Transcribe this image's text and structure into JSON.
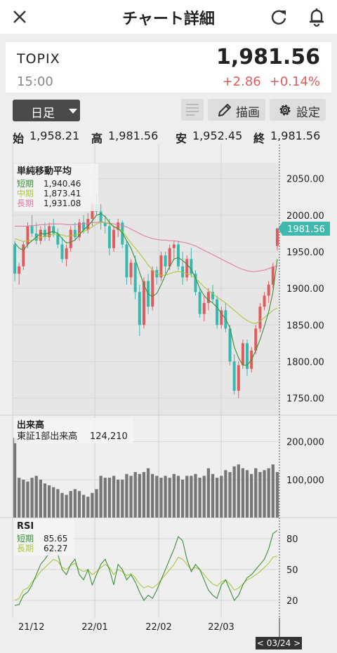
{
  "header": {
    "title": "チャート詳細"
  },
  "quote": {
    "symbol": "TOPIX",
    "time": "15:00",
    "price": "1,981.56",
    "change": "+2.86",
    "change_pct": "+0.14%"
  },
  "controls": {
    "period": "日足",
    "draw_label": "描画",
    "settings_label": "設定"
  },
  "ohlc": [
    {
      "key": "始",
      "value": "1,958.21"
    },
    {
      "key": "高",
      "value": "1,981.56"
    },
    {
      "key": "安",
      "value": "1,952.45"
    },
    {
      "key": "終",
      "value": "1,981.56"
    }
  ],
  "colors": {
    "up": "#e05b5b",
    "down": "#35b8b0",
    "short_ma": "#3a8e3a",
    "mid_ma": "#a8c83a",
    "long_ma": "#e07aa8",
    "volume": "#777777",
    "rsi_short": "#3a8e3a",
    "rsi_long": "#a8c83a",
    "accent": "#3fb8ad"
  },
  "chart_data": [
    {
      "type": "line",
      "title": "単純移動平均",
      "legend": [
        {
          "name": "短期",
          "value": "1,940.46"
        },
        {
          "name": "中期",
          "value": "1,873.41"
        },
        {
          "name": "長期",
          "value": "1,931.08"
        }
      ],
      "y_ticks": [
        "2050.00",
        "2000.00",
        "1950.00",
        "1900.00",
        "1850.00",
        "1800.00",
        "1750.00"
      ],
      "ylim": [
        1740,
        2065
      ],
      "x_ticks": [
        "21/12",
        "22/01",
        "22/02",
        "22/03"
      ],
      "last_price_label": "1981.56",
      "candles": [
        [
          1960,
          1965,
          1910,
          1920
        ],
        [
          1920,
          1935,
          1905,
          1930
        ],
        [
          1930,
          1965,
          1925,
          1960
        ],
        [
          1960,
          1990,
          1955,
          1985
        ],
        [
          1985,
          2000,
          1970,
          1975
        ],
        [
          1975,
          1990,
          1960,
          1965
        ],
        [
          1965,
          1985,
          1960,
          1980
        ],
        [
          1980,
          1990,
          1965,
          1970
        ],
        [
          1970,
          1990,
          1965,
          1985
        ],
        [
          1985,
          1995,
          1970,
          1975
        ],
        [
          1975,
          1982,
          1955,
          1960
        ],
        [
          1960,
          1970,
          1935,
          1940
        ],
        [
          1940,
          1960,
          1930,
          1955
        ],
        [
          1955,
          1985,
          1950,
          1980
        ],
        [
          1980,
          1990,
          1965,
          1970
        ],
        [
          1970,
          1995,
          1965,
          1990
        ],
        [
          1990,
          2000,
          1975,
          1980
        ],
        [
          1980,
          2003,
          1975,
          1995
        ],
        [
          1995,
          2020,
          1985,
          2015
        ],
        [
          2015,
          2030,
          2000,
          2005
        ],
        [
          2005,
          2015,
          1980,
          1990
        ],
        [
          1990,
          2000,
          1975,
          1985
        ],
        [
          1985,
          1995,
          1945,
          1955
        ],
        [
          1955,
          1985,
          1950,
          1980
        ],
        [
          1980,
          1995,
          1970,
          1990
        ],
        [
          1990,
          1993,
          1955,
          1960
        ],
        [
          1960,
          1965,
          1905,
          1915
        ],
        [
          1915,
          1940,
          1905,
          1935
        ],
        [
          1935,
          1945,
          1885,
          1895
        ],
        [
          1895,
          1905,
          1835,
          1850
        ],
        [
          1850,
          1915,
          1845,
          1910
        ],
        [
          1910,
          1920,
          1865,
          1875
        ],
        [
          1875,
          1930,
          1870,
          1925
        ],
        [
          1925,
          1930,
          1905,
          1915
        ],
        [
          1915,
          1950,
          1910,
          1945
        ],
        [
          1945,
          1950,
          1920,
          1930
        ],
        [
          1930,
          1960,
          1925,
          1955
        ],
        [
          1955,
          1965,
          1940,
          1960
        ],
        [
          1960,
          1965,
          1925,
          1930
        ],
        [
          1930,
          1950,
          1905,
          1915
        ],
        [
          1915,
          1945,
          1910,
          1940
        ],
        [
          1940,
          1955,
          1915,
          1920
        ],
        [
          1920,
          1925,
          1890,
          1895
        ],
        [
          1895,
          1900,
          1860,
          1865
        ],
        [
          1865,
          1890,
          1855,
          1880
        ],
        [
          1880,
          1900,
          1870,
          1895
        ],
        [
          1895,
          1905,
          1880,
          1885
        ],
        [
          1885,
          1890,
          1845,
          1850
        ],
        [
          1850,
          1875,
          1845,
          1870
        ],
        [
          1870,
          1880,
          1840,
          1845
        ],
        [
          1845,
          1850,
          1795,
          1800
        ],
        [
          1800,
          1810,
          1755,
          1760
        ],
        [
          1760,
          1800,
          1750,
          1795
        ],
        [
          1795,
          1830,
          1790,
          1825
        ],
        [
          1825,
          1830,
          1780,
          1790
        ],
        [
          1790,
          1820,
          1785,
          1815
        ],
        [
          1815,
          1850,
          1810,
          1845
        ],
        [
          1845,
          1880,
          1840,
          1875
        ],
        [
          1875,
          1895,
          1870,
          1890
        ],
        [
          1890,
          1910,
          1880,
          1905
        ],
        [
          1905,
          1935,
          1900,
          1930
        ],
        [
          1958,
          1982,
          1952,
          1982
        ]
      ],
      "sma_short": [
        1962,
        1955,
        1952,
        1960,
        1965,
        1970,
        1975,
        1974,
        1976,
        1978,
        1975,
        1968,
        1962,
        1963,
        1966,
        1973,
        1980,
        1985,
        1992,
        2000,
        2002,
        1998,
        1990,
        1984,
        1982,
        1976,
        1965,
        1955,
        1940,
        1922,
        1905,
        1892,
        1889,
        1893,
        1905,
        1918,
        1930,
        1940,
        1942,
        1938,
        1933,
        1926,
        1914,
        1900,
        1890,
        1884,
        1880,
        1874,
        1866,
        1858,
        1846,
        1820,
        1805,
        1795,
        1795,
        1802,
        1815,
        1830,
        1848,
        1868,
        1895,
        1940
      ],
      "sma_mid": [
        1968,
        1966,
        1964,
        1965,
        1966,
        1968,
        1970,
        1971,
        1972,
        1974,
        1974,
        1973,
        1971,
        1972,
        1973,
        1975,
        1978,
        1980,
        1984,
        1988,
        1990,
        1990,
        1988,
        1985,
        1982,
        1978,
        1970,
        1962,
        1955,
        1948,
        1940,
        1932,
        1925,
        1920,
        1918,
        1918,
        1920,
        1922,
        1923,
        1922,
        1920,
        1918,
        1914,
        1908,
        1902,
        1897,
        1893,
        1888,
        1884,
        1880,
        1875,
        1870,
        1865,
        1860,
        1856,
        1853,
        1852,
        1855,
        1860,
        1865,
        1870,
        1873
      ],
      "sma_long": [
        1985,
        1985,
        1985,
        1985,
        1986,
        1986,
        1987,
        1987,
        1988,
        1988,
        1988,
        1988,
        1987,
        1987,
        1987,
        1988,
        1988,
        1989,
        1990,
        1990,
        1991,
        1990,
        1989,
        1988,
        1987,
        1986,
        1984,
        1981,
        1978,
        1975,
        1972,
        1970,
        1968,
        1967,
        1966,
        1966,
        1965,
        1965,
        1964,
        1963,
        1962,
        1960,
        1958,
        1955,
        1952,
        1949,
        1946,
        1943,
        1940,
        1937,
        1934,
        1931,
        1928,
        1926,
        1924,
        1923,
        1923,
        1924,
        1925,
        1927,
        1929,
        1931
      ]
    },
    {
      "type": "bar",
      "title": "出来高",
      "legend": [
        {
          "name": "東証1部出来高",
          "value": "124,210"
        }
      ],
      "y_ticks": [
        "200,000",
        "100,000"
      ],
      "ylim": [
        0,
        240000
      ],
      "values": [
        210000,
        105000,
        100000,
        95000,
        105000,
        110000,
        100000,
        90000,
        85000,
        80000,
        75000,
        65000,
        60000,
        70000,
        75000,
        70000,
        60000,
        55000,
        65000,
        75000,
        110000,
        105000,
        105000,
        110000,
        100000,
        100000,
        115000,
        110000,
        120000,
        115000,
        120000,
        130000,
        115000,
        110000,
        105000,
        110000,
        105000,
        115000,
        110000,
        100000,
        110000,
        110000,
        115000,
        105000,
        110000,
        130000,
        115000,
        105000,
        110000,
        125000,
        120000,
        135000,
        140000,
        130000,
        125000,
        115000,
        130000,
        120000,
        125000,
        130000,
        140000,
        120000
      ]
    },
    {
      "type": "line",
      "title": "RSI",
      "legend": [
        {
          "name": "短期",
          "value": "85.65"
        },
        {
          "name": "長期",
          "value": "62.27"
        }
      ],
      "y_ticks": [
        "80",
        "50",
        "20"
      ],
      "ylim": [
        5,
        95
      ],
      "rsi_short": [
        15,
        16,
        25,
        28,
        35,
        45,
        55,
        60,
        66,
        70,
        65,
        50,
        45,
        55,
        60,
        45,
        40,
        50,
        35,
        45,
        55,
        60,
        50,
        35,
        55,
        50,
        40,
        45,
        38,
        28,
        20,
        25,
        22,
        30,
        40,
        50,
        60,
        70,
        82,
        78,
        60,
        48,
        55,
        50,
        40,
        30,
        25,
        22,
        35,
        40,
        30,
        20,
        25,
        35,
        42,
        45,
        50,
        55,
        60,
        70,
        85,
        88
      ],
      "rsi_long": [
        20,
        22,
        30,
        32,
        38,
        42,
        48,
        52,
        56,
        60,
        58,
        52,
        50,
        54,
        56,
        50,
        48,
        50,
        45,
        48,
        52,
        55,
        52,
        45,
        50,
        48,
        44,
        46,
        42,
        36,
        32,
        34,
        32,
        35,
        40,
        45,
        50,
        55,
        62,
        60,
        55,
        50,
        52,
        50,
        45,
        40,
        36,
        34,
        38,
        40,
        36,
        30,
        32,
        36,
        40,
        42,
        45,
        48,
        52,
        56,
        62,
        63
      ]
    }
  ],
  "cursor_label": "< 03/24 >"
}
